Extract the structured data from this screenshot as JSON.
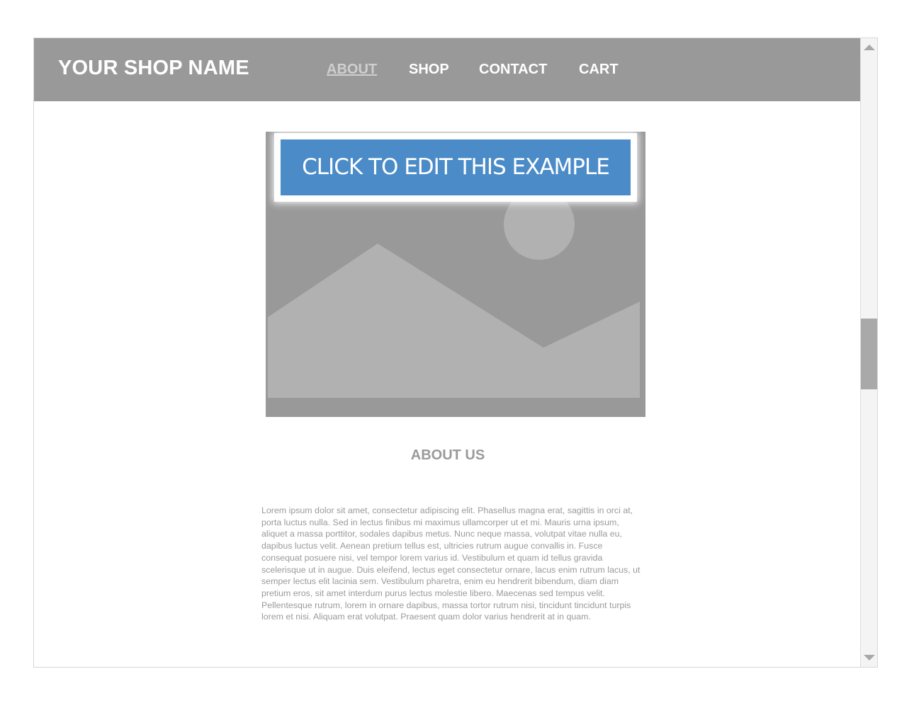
{
  "header": {
    "shop_name": "YOUR SHOP NAME",
    "nav": [
      {
        "label": "ABOUT",
        "active": true
      },
      {
        "label": "SHOP",
        "active": false
      },
      {
        "label": "CONTACT",
        "active": false
      },
      {
        "label": "CART",
        "active": false
      }
    ]
  },
  "hero": {
    "image_icon": "landscape-placeholder-icon",
    "edit_button_label": "CLICK TO EDIT THIS EXAMPLE"
  },
  "about": {
    "title": "ABOUT US",
    "body": "Lorem ipsum dolor sit amet, consectetur adipiscing elit. Phasellus magna erat, sagittis in orci at, porta luctus nulla. Sed in lectus finibus mi maximus ullamcorper ut et mi. Mauris urna ipsum, aliquet a massa porttitor, sodales dapibus metus. Nunc neque massa, volutpat vitae nulla eu, dapibus luctus velit. Aenean pretium tellus est, ultricies rutrum augue convallis in. Fusce consequat posuere nisi, vel tempor lorem varius id. Vestibulum et quam id tellus gravida scelerisque ut in augue. Duis eleifend, lectus eget consectetur ornare, lacus enim rutrum lacus, ut semper lectus elit lacinia sem. Vestibulum pharetra, enim eu hendrerit bibendum, diam diam pretium eros, sit amet interdum purus lectus molestie libero. Maecenas sed tempus velit. Pellentesque rutrum, lorem in ornare dapibus, massa tortor rutrum nisi, tincidunt tincidunt turpis lorem et nisi. Aliquam erat volutpat. Praesent  quam dolor varius hendrerit at in quam."
  },
  "colors": {
    "navbar": "#999999",
    "accent": "#4a8bc8",
    "text_muted": "#9a9a9a"
  }
}
